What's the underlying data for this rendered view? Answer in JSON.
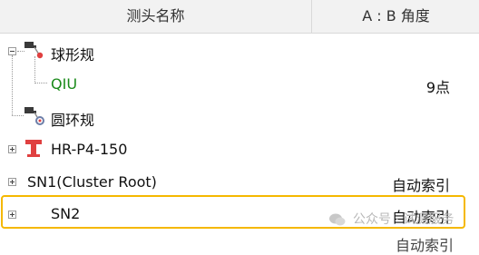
{
  "header": {
    "col_name": "测头名称",
    "col_angle": "A : B 角度"
  },
  "rows": [
    {
      "label": "球形规",
      "value": ""
    },
    {
      "label": "QIU",
      "value": "9点"
    },
    {
      "label": "圆环规",
      "value": ""
    },
    {
      "label": "HR-P4-150",
      "value": ""
    },
    {
      "label": "SN1(Cluster Root)",
      "value": "自动索引"
    },
    {
      "label": "SN2",
      "value": "自动索引"
    }
  ],
  "partial_row_value": "自动索引",
  "watermark": "公众号 · 试测服务",
  "colors": {
    "qiu_text": "#1a8a1a",
    "highlight_border": "#f5b800",
    "probe_red": "#e04040"
  },
  "icons": [
    "sphere-probe-icon",
    "ring-gauge-icon",
    "t-probe-icon",
    "wechat-icon"
  ]
}
